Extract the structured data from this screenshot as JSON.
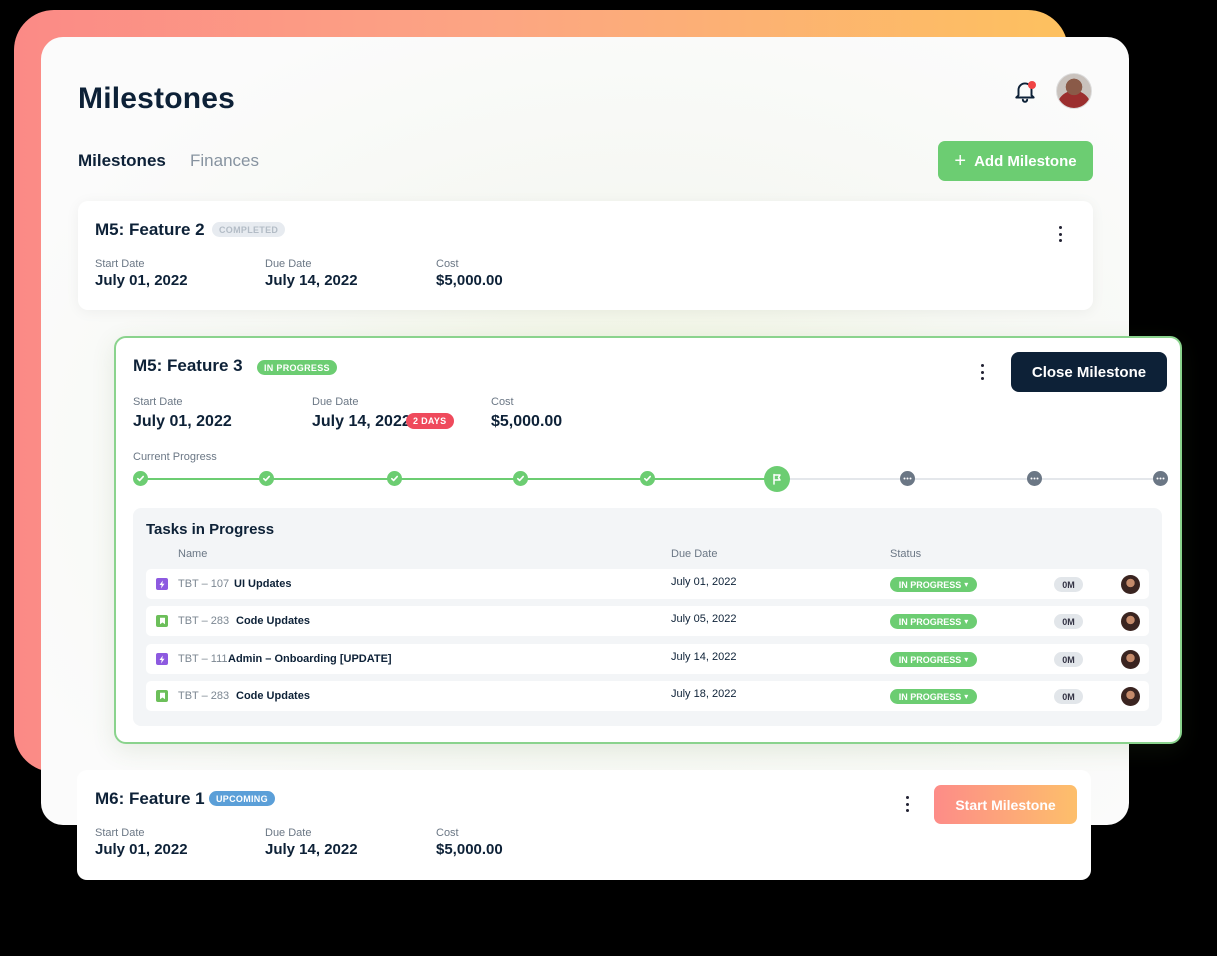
{
  "page": {
    "title": "Milestones"
  },
  "tabs": [
    {
      "label": "Milestones",
      "active": true
    },
    {
      "label": "Finances",
      "active": false
    }
  ],
  "header": {
    "notification_icon": "bell-icon",
    "notification_dot_color": "#f04444"
  },
  "add_button": {
    "label": "Add Milestone",
    "icon": "plus-icon"
  },
  "field_labels": {
    "start": "Start Date",
    "due": "Due Date",
    "cost": "Cost"
  },
  "milestones": [
    {
      "title": "M5: Feature 2",
      "badge": "COMPLETED",
      "start": "July 01, 2022",
      "due": "July 14, 2022",
      "cost": "$5,000.00"
    },
    {
      "title": "M5: Feature 3",
      "badge": "IN PROGRESS",
      "start": "July 01, 2022",
      "due": "July 14, 2022",
      "due_badge": "2 DAYS",
      "cost": "$5,000.00",
      "action": "Close Milestone",
      "progress_label": "Current Progress",
      "progress_steps": [
        "done",
        "done",
        "done",
        "done",
        "done",
        "current",
        "todo",
        "todo",
        "todo"
      ],
      "tasks_title": "Tasks in Progress",
      "task_columns": {
        "name": "Name",
        "due": "Due Date",
        "status": "Status"
      },
      "tasks": [
        {
          "type": "lightning",
          "key": "TBT – 107",
          "name": "UI Updates",
          "due": "July 01, 2022",
          "status": "IN PROGRESS",
          "time": "0M"
        },
        {
          "type": "bookmark",
          "key": "TBT – 283",
          "name": "Code Updates",
          "due": "July 05, 2022",
          "status": "IN PROGRESS",
          "time": "0M"
        },
        {
          "type": "lightning",
          "key": "TBT – 111",
          "name": "Admin – Onboarding [UPDATE]",
          "due": "July 14, 2022",
          "status": "IN PROGRESS",
          "time": "0M"
        },
        {
          "type": "bookmark",
          "key": "TBT – 283",
          "name": "Code Updates",
          "due": "July 18, 2022",
          "status": "IN PROGRESS",
          "time": "0M"
        }
      ]
    },
    {
      "title": "M6: Feature 1",
      "badge": "UPCOMING",
      "start": "July 01, 2022",
      "due": "July 14, 2022",
      "cost": "$5,000.00",
      "action": "Start Milestone"
    }
  ],
  "colors": {
    "accent_green": "#6ccd72",
    "navy": "#0d2137",
    "upcoming_blue": "#5b9fd8",
    "alert_red": "#ef4a5c"
  }
}
